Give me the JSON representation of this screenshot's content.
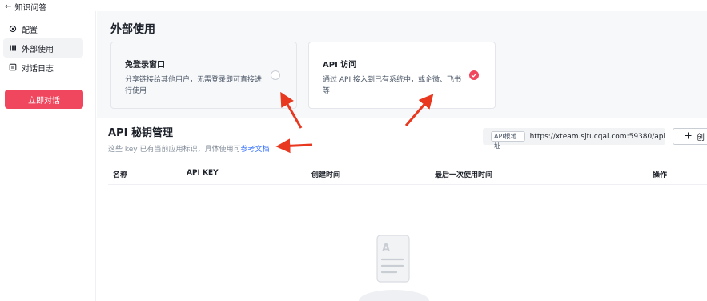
{
  "topbar": {
    "back_label": "知识问答"
  },
  "sidebar": {
    "items": [
      {
        "label": "配置",
        "icon": "gear-icon"
      },
      {
        "label": "外部使用",
        "icon": "columns-icon"
      },
      {
        "label": "对话日志",
        "icon": "log-icon"
      }
    ],
    "active_index": 1,
    "chat_button": "立即对话"
  },
  "main": {
    "section_title": "外部使用",
    "cards": [
      {
        "title": "免登录窗口",
        "desc": "分享链接给其他用户，无需登录即可直接进行使用",
        "checked": false
      },
      {
        "title": "API 访问",
        "desc": "通过 API 接入到已有系统中，或企微、飞书等",
        "checked": true
      }
    ]
  },
  "api": {
    "title": "API 秘钥管理",
    "subtitle": "这些 key 已有当前应用标识，具体使用可",
    "doc_link": "参考文档",
    "url_tag": "API根地址",
    "url": "https://xteam.sjtucqai.com:59380/api",
    "create_label": "创",
    "columns": [
      "名称",
      "API KEY",
      "创建时间",
      "最后一次使用时间",
      "操作"
    ]
  },
  "colors": {
    "accent": "#f0475e",
    "link": "#3370ff",
    "annotation_arrow": "#e8381f"
  }
}
